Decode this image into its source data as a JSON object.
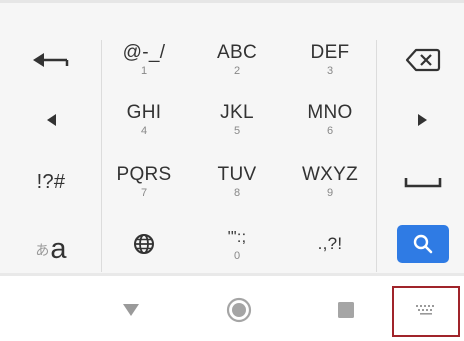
{
  "keyboard": {
    "row1": [
      {
        "main": "@-_/",
        "sub": "1"
      },
      {
        "main": "ABC",
        "sub": "2"
      },
      {
        "main": "DEF",
        "sub": "3"
      }
    ],
    "row2": [
      {
        "main": "GHI",
        "sub": "4"
      },
      {
        "main": "JKL",
        "sub": "5"
      },
      {
        "main": "MNO",
        "sub": "6"
      }
    ],
    "row3": [
      {
        "main": "PQRS",
        "sub": "7"
      },
      {
        "main": "TUV",
        "sub": "8"
      },
      {
        "main": "WXYZ",
        "sub": "9"
      }
    ],
    "row4": [
      {
        "main": "'\":;",
        "sub": "0"
      },
      {
        "main": ".,?!",
        "sub": ""
      }
    ],
    "symbols_label": "!?#",
    "kana_label": "あ",
    "alpha_label": "a"
  },
  "icons": {
    "backspace_left": "arrow-left-icon",
    "delete": "backspace-x-icon",
    "cursor_left": "triangle-left-icon",
    "cursor_right": "triangle-right-icon",
    "space": "space-bar-icon",
    "globe": "globe-icon",
    "search": "search-icon",
    "nav_back": "triangle-down-icon",
    "nav_home": "circle-home-icon",
    "nav_recents": "square-recents-icon",
    "nav_keyboard": "keyboard-icon"
  },
  "colors": {
    "search_key": "#2f7be4",
    "highlight_box": "#a0242a"
  }
}
